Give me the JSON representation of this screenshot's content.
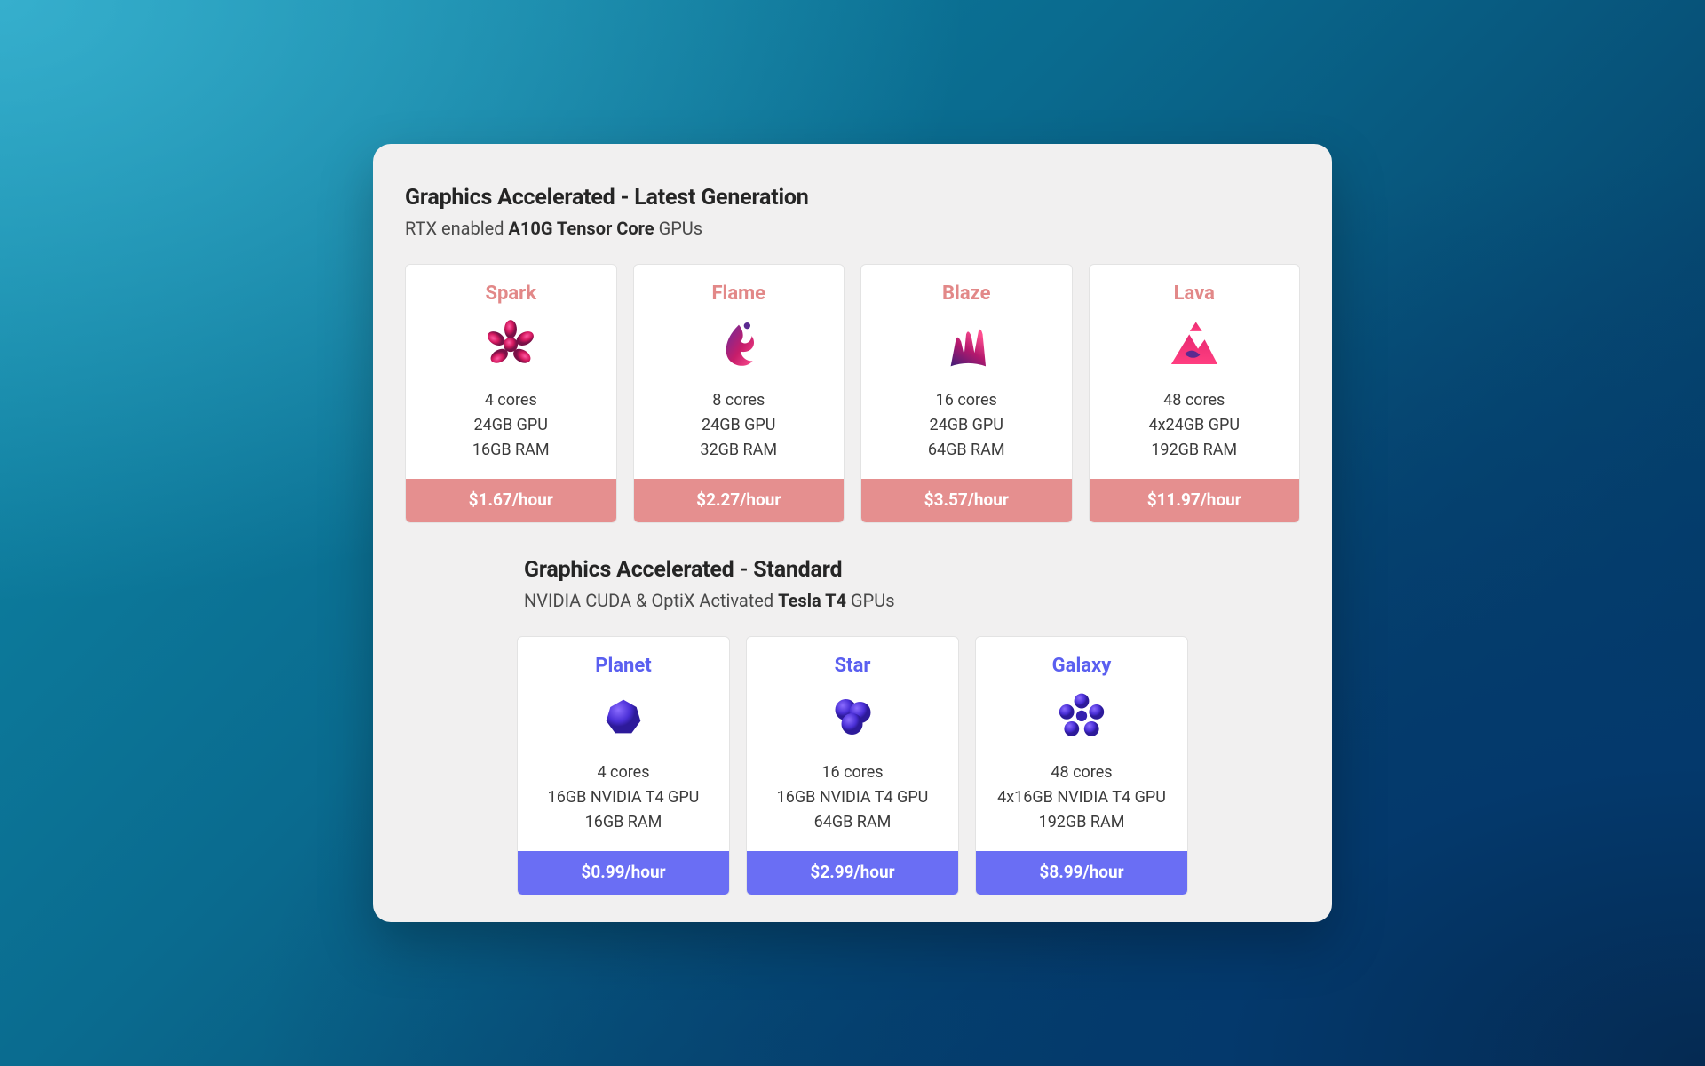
{
  "colors": {
    "red": "#e58f8f",
    "blue": "#6a6ef4"
  },
  "sections": {
    "latest": {
      "heading": "Graphics Accelerated - Latest Generation",
      "sub_prefix": "RTX enabled ",
      "sub_bold": "A10G Tensor Core",
      "sub_suffix": " GPUs",
      "tier_color": "red",
      "tiers": [
        {
          "name": "Spark",
          "icon": "spark-icon",
          "cores": "4 cores",
          "gpu": "24GB GPU",
          "ram": "16GB RAM",
          "price": "$1.67/hour"
        },
        {
          "name": "Flame",
          "icon": "flame-icon",
          "cores": "8 cores",
          "gpu": "24GB GPU",
          "ram": "32GB RAM",
          "price": "$2.27/hour"
        },
        {
          "name": "Blaze",
          "icon": "blaze-icon",
          "cores": "16 cores",
          "gpu": "24GB GPU",
          "ram": "64GB RAM",
          "price": "$3.57/hour"
        },
        {
          "name": "Lava",
          "icon": "lava-icon",
          "cores": "48 cores",
          "gpu": "4x24GB GPU",
          "ram": "192GB RAM",
          "price": "$11.97/hour"
        }
      ]
    },
    "standard": {
      "heading": "Graphics Accelerated - Standard",
      "sub_prefix": "NVIDIA CUDA & OptiX Activated ",
      "sub_bold": "Tesla T4",
      "sub_suffix": " GPUs",
      "tier_color": "blue",
      "tiers": [
        {
          "name": "Planet",
          "icon": "planet-icon",
          "cores": "4 cores",
          "gpu": "16GB NVIDIA T4 GPU",
          "ram": "16GB RAM",
          "price": "$0.99/hour"
        },
        {
          "name": "Star",
          "icon": "star-icon",
          "cores": "16 cores",
          "gpu": "16GB NVIDIA T4 GPU",
          "ram": "64GB RAM",
          "price": "$2.99/hour"
        },
        {
          "name": "Galaxy",
          "icon": "galaxy-icon",
          "cores": "48 cores",
          "gpu": "4x16GB NVIDIA T4 GPU",
          "ram": "192GB RAM",
          "price": "$8.99/hour"
        }
      ]
    }
  }
}
